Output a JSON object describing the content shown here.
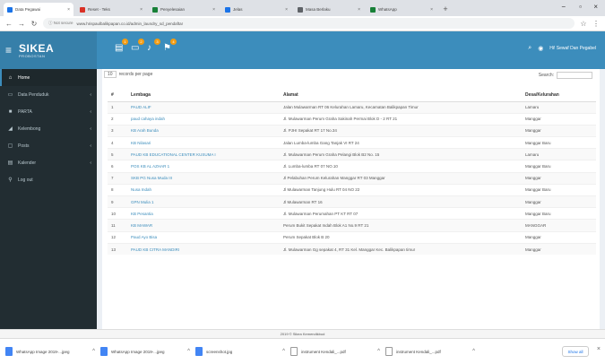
{
  "browser": {
    "tabs": [
      {
        "label": "Data Pegawai",
        "color": "#1a73e8",
        "active": true
      },
      {
        "label": "Reset - Teks",
        "color": "#d93025",
        "active": false
      },
      {
        "label": "Penyelesaian",
        "color": "#188038",
        "active": false
      },
      {
        "label": "Jelas",
        "color": "#1a73e8",
        "active": false
      },
      {
        "label": "Masa Berlaku",
        "color": "#5f6368",
        "active": false
      },
      {
        "label": "WhatsApp",
        "color": "#188038",
        "active": false
      }
    ],
    "new_tab": "+",
    "win_min": "−",
    "win_max": "▫",
    "win_close": "×",
    "back": "←",
    "forward": "→",
    "reload": "↻",
    "security": "ⓘ Not secure",
    "url": "www.hrispaulbalikpapan.co.id/admin_laundry_sd_pendaftar",
    "star": "☆",
    "menu": "⋮"
  },
  "app": {
    "hamburger": "≡",
    "brand": "SIKEA",
    "brand_sub": "PROBOSTAN",
    "badges": [
      "1",
      "2",
      "3",
      "4"
    ],
    "search_icon": "⌕",
    "user_icon": "◉",
    "user": "Hi! Sewaf Dan Pegabel"
  },
  "sidebar": {
    "items": [
      {
        "icon": "⌂",
        "label": "Home",
        "caret": "",
        "active": true
      },
      {
        "icon": "▭",
        "label": "Data Penduduk",
        "caret": "‹",
        "active": false
      },
      {
        "icon": "■",
        "label": "PARTA",
        "caret": "‹",
        "active": false
      },
      {
        "icon": "◢",
        "label": "Kelembong",
        "caret": "‹",
        "active": false
      },
      {
        "icon": "▢",
        "label": "Posts",
        "caret": "‹",
        "active": false
      },
      {
        "icon": "▤",
        "label": "Kalender",
        "caret": "‹",
        "active": false
      },
      {
        "icon": "⚲",
        "label": "Log out",
        "caret": "",
        "active": false
      }
    ]
  },
  "table": {
    "length_value": "10",
    "length_suffix": "records per page",
    "search_label": "Search:",
    "headers": [
      "#",
      "Lembaga",
      "Alamat",
      "Desa/Kelurahan"
    ],
    "rows": [
      [
        "1",
        "PAUD ALIF",
        "Jalan Mulawarman RT 06 Kelurahan Lamaru, Kecamatan Balikpapan Timur",
        "Lamaru"
      ],
      [
        "2",
        "paud cahaya indah",
        "Jl. Mulawarman Perum Graha Sakinah Permai Blok D - 2 RT 21",
        "Manggar"
      ],
      [
        "3",
        "KB Arah Bunda",
        "Jl. PJHI Sepakat RT 17 No.34",
        "Manggar"
      ],
      [
        "4",
        "KB Nilasari",
        "Jalan Lumba-lumba Gang Tanjak VI RT 24",
        "Manggar Baru"
      ],
      [
        "5",
        "PAUD KB EDUCATIONAL CENTER KUSUMA I",
        "Jl. Mulawarman Perum Graha Pelangi Blok B2 No. 15",
        "Lamaru"
      ],
      [
        "6",
        "POS KB AL AZHAR 1",
        "Jl. Lumba-lumba RT 07 NO.10",
        "Manggar Baru"
      ],
      [
        "7",
        "SKB PG Nusa Muda III",
        "Jl Pelabuhan Perum Kelurahan Manggar RT 03 Manggar",
        "Manggar"
      ],
      [
        "8",
        "Nusa Indah",
        "Jl Mulawarman Tanjung Hulu RT 04 NO 22",
        "Manggar Baru"
      ],
      [
        "9",
        "GPN Mulia 1",
        "Jl Mulawarman RT 16",
        "Manggar"
      ],
      [
        "10",
        "KB Pesantia",
        "Jl. Mulawarman Perumahan PT KT RT 07",
        "Manggar Baru"
      ],
      [
        "11",
        "KB MAWAR",
        "Perum Bukit Sepakat Indah Blok A1 No.9 RT 21",
        "MANGGAR"
      ],
      [
        "12",
        "Paud Ayo Bisa",
        "Perum Sepakat Blok B 20",
        "Manggar"
      ],
      [
        "13",
        "PAUD KB CITRA MANDIRI",
        "Jl. Mulawarman Gg sepakat 4, RT 31 Kel. Manggar Kec. Balikpapan timur",
        "Manggar"
      ]
    ]
  },
  "footer": {
    "text": "2019 © Sikea Kemendikbud"
  },
  "downloads": {
    "items": [
      {
        "name": "WhatsApp Image 2019-...jpeg",
        "chevron": "^"
      },
      {
        "name": "WhatsApp Image 2019-...jpeg",
        "chevron": "^"
      },
      {
        "name": "screenshot.jpg",
        "chevron": "^"
      },
      {
        "name": "instrument Kendali_...pdf",
        "chevron": "^"
      },
      {
        "name": "instrument Kendali_...pdf",
        "chevron": "^"
      }
    ],
    "show_all": "Show all",
    "close": "×"
  }
}
